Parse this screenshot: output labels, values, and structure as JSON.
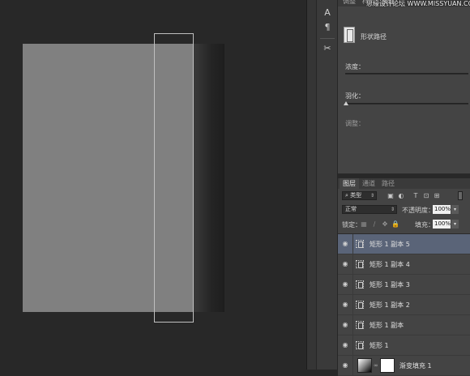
{
  "watermark": "思缘设计论坛 WWW.MISSYUAN.COM",
  "toolstrip": {
    "tools": [
      "text-tool-icon",
      "paragraph-tool-icon",
      "adjust-tool-icon"
    ],
    "tool_glyphs": [
      "A",
      "¶",
      "✂"
    ]
  },
  "properties": {
    "tabs": [
      "调整",
      "样式",
      "属性"
    ],
    "shape_label": "形状路径",
    "density_label": "浓度：",
    "feather_label": "羽化：",
    "refine_label": "调整："
  },
  "layers_panel": {
    "tabs": [
      "图层",
      "通道",
      "路径"
    ],
    "filter_label": "类型",
    "blend_mode": "正常",
    "opacity_label": "不透明度：",
    "opacity_value": "100%",
    "lock_label": "锁定：",
    "fill_label": "填充：",
    "fill_value": "100%",
    "layers": [
      {
        "name": "矩形 1 副本 5",
        "selected": true
      },
      {
        "name": "矩形 1 副本 4",
        "selected": false
      },
      {
        "name": "矩形 1 副本 3",
        "selected": false
      },
      {
        "name": "矩形 1 副本 2",
        "selected": false
      },
      {
        "name": "矩形 1 副本",
        "selected": false
      },
      {
        "name": "矩形 1",
        "selected": false
      },
      {
        "name": "渐变填充 1",
        "selected": false
      }
    ]
  },
  "colors": {
    "canvas_bg": "#282828",
    "doc_fill": "#808080",
    "panel_bg": "#444444",
    "selection_highlight": "#5a6478"
  }
}
